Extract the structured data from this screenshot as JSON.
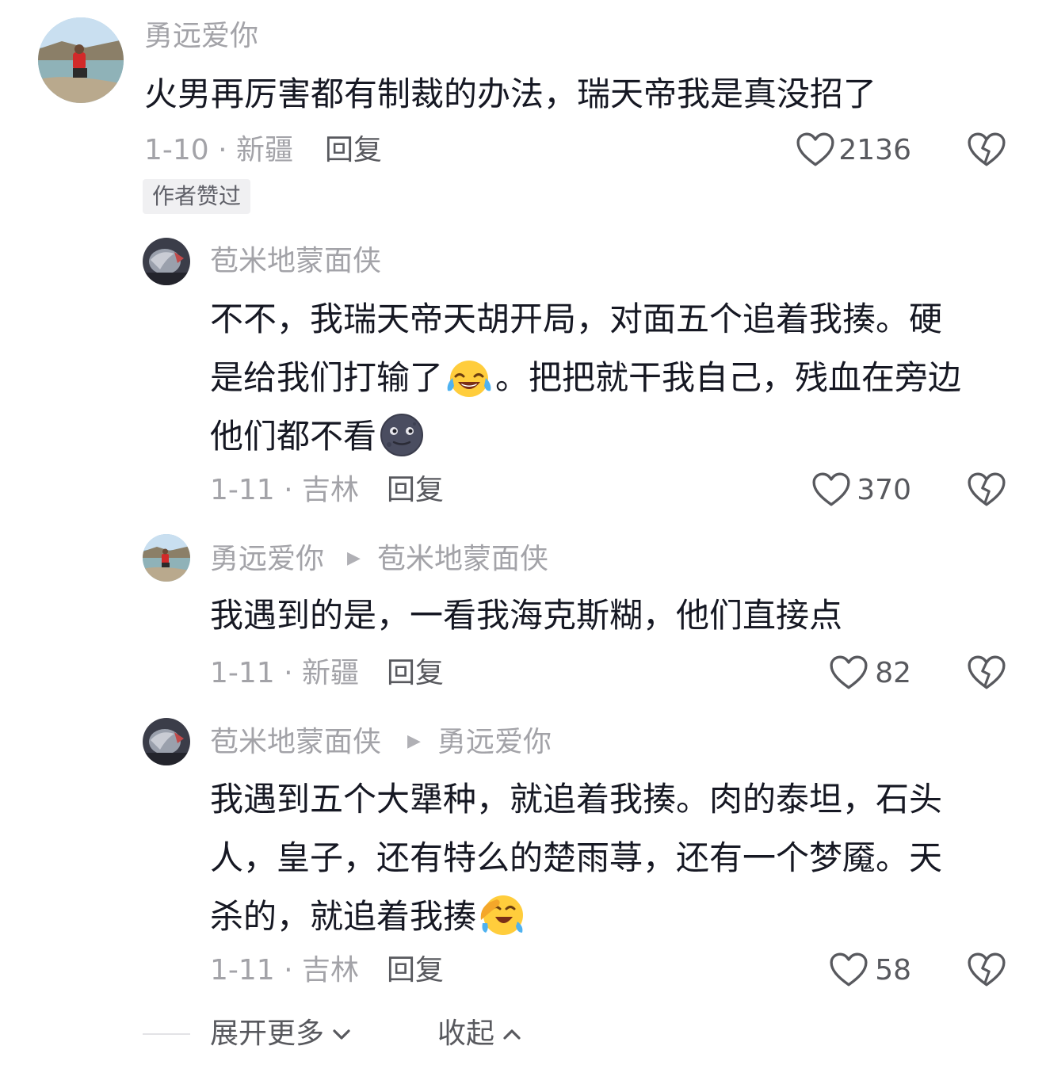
{
  "comments": [
    {
      "author": "勇远爱你",
      "text": "火男再厉害都有制裁的办法，瑞天帝我是真没招了",
      "meta": "1-10 · 新疆",
      "reply": "回复",
      "likes": "2136",
      "badge": "作者赞过"
    },
    {
      "author": "苞米地蒙面侠",
      "lines": [
        "不不，我瑞天帝天胡开局，对面五个追着我揍。硬",
        "是给我们打输了",
        "。把把就干我自己，残血在旁边",
        "他们都不看"
      ],
      "meta": "1-11 · 吉林",
      "reply": "回复",
      "likes": "370"
    },
    {
      "author": "勇远爱你",
      "reply_to": "苞米地蒙面侠",
      "text": "我遇到的是，一看我海克斯糊，他们直接点",
      "meta": "1-11 · 新疆",
      "reply": "回复",
      "likes": "82"
    },
    {
      "author": "苞米地蒙面侠",
      "reply_to": "勇远爱你",
      "lines": [
        "我遇到五个大犟种，就追着我揍。肉的泰坦，石头",
        "人，皇子，还有特么的楚雨荨，还有一个梦魇。天",
        "杀的，就追着我揍"
      ],
      "meta": "1-11 · 吉林",
      "reply": "回复",
      "likes": "58"
    }
  ],
  "footer": {
    "expand": "展开更多",
    "collapse": "收起"
  },
  "icons": {
    "like": "heart-outline-icon",
    "dislike": "broken-heart-icon",
    "reply_arrow": "play-triangle-icon",
    "emoji_1": "face-with-tears-of-joy-emoji",
    "emoji_2": "new-moon-face-emoji",
    "emoji_3": "face-with-hand-over-mouth-emoji",
    "expand": "chevron-down-icon",
    "collapse": "chevron-up-icon"
  },
  "colors": {
    "text": "#161823",
    "secondary": "#a3a3a8",
    "action": "#58595e"
  }
}
